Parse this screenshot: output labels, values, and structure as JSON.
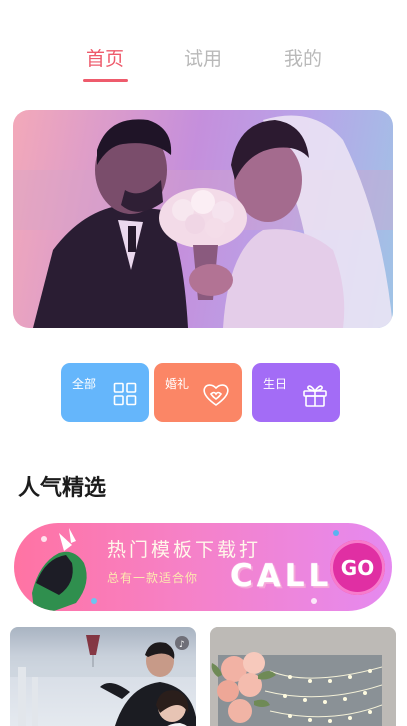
{
  "tabs": [
    {
      "label": "首页",
      "active": true
    },
    {
      "label": "试用",
      "active": false
    },
    {
      "label": "我的",
      "active": false
    }
  ],
  "hero": {
    "image": "wedding-couple-photo"
  },
  "categories": [
    {
      "label": "全部",
      "icon": "grid-icon",
      "color": "#65b6fb"
    },
    {
      "label": "婚礼",
      "icon": "heart-icon",
      "color": "#fb8666"
    },
    {
      "label": "生日",
      "icon": "gift-icon",
      "color": "#a36cf6"
    }
  ],
  "section": {
    "title": "人气精选"
  },
  "promo": {
    "title": "热门模板下载打",
    "subtitle": "总有一款适合你",
    "call": "CALL",
    "go": "GO"
  },
  "cards": [
    {
      "image": "wedding-toast-photo"
    },
    {
      "image": "floral-string-lights-photo"
    }
  ],
  "colors": {
    "accent": "#ee5b6c",
    "inactive_tab": "#b9b9b9"
  }
}
